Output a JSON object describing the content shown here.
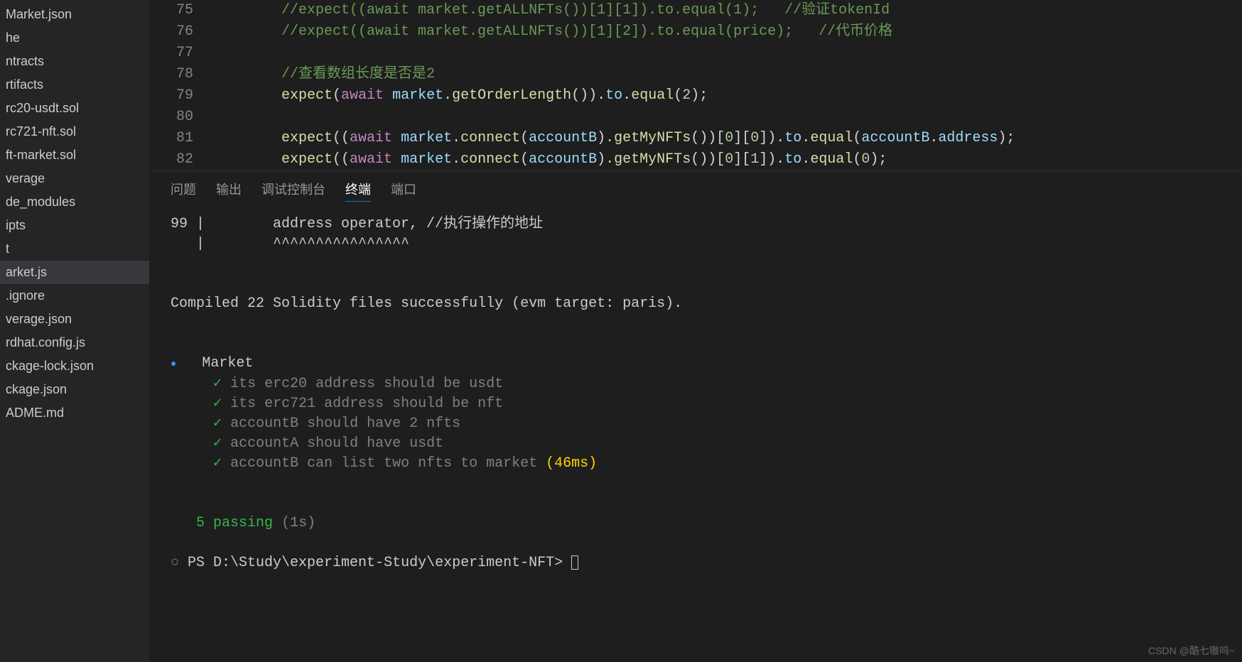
{
  "sidebar": {
    "items": [
      {
        "label": "Market.json"
      },
      {
        "label": "he"
      },
      {
        "label": "ntracts"
      },
      {
        "label": "rtifacts"
      },
      {
        "label": "rc20-usdt.sol"
      },
      {
        "label": "rc721-nft.sol"
      },
      {
        "label": "ft-market.sol"
      },
      {
        "label": "verage"
      },
      {
        "label": "de_modules"
      },
      {
        "label": "ipts"
      },
      {
        "label": "t"
      },
      {
        "label": "arket.js"
      },
      {
        "label": ".ignore"
      },
      {
        "label": "verage.json"
      },
      {
        "label": "rdhat.config.js"
      },
      {
        "label": "ckage-lock.json"
      },
      {
        "label": "ckage.json"
      },
      {
        "label": "ADME.md"
      }
    ],
    "active_index": 11
  },
  "editor": {
    "lines": [
      {
        "num": "75",
        "html": "<span class='c-comment'>//expect((await market.getALLNFTs())[1][1]).to.equal(1);   //验证tokenId</span>"
      },
      {
        "num": "76",
        "html": "<span class='c-comment'>//expect((await market.getALLNFTs())[1][2]).to.equal(price);   //代币价格</span>"
      },
      {
        "num": "77",
        "html": ""
      },
      {
        "num": "78",
        "html": "<span class='c-comment'>//查看数组长度是否是2</span>"
      },
      {
        "num": "79",
        "html": "<span class='c-func'>expect</span><span class='c-punct'>(</span><span class='c-await'>await</span> <span class='c-ident'>market</span><span class='c-punct'>.</span><span class='c-func'>getOrderLength</span><span class='c-punct'>()).</span><span class='c-ident'>to</span><span class='c-punct'>.</span><span class='c-func'>equal</span><span class='c-punct'>(</span><span class='c-num'>2</span><span class='c-punct'>);</span>"
      },
      {
        "num": "80",
        "html": ""
      },
      {
        "num": "81",
        "html": "<span class='c-func'>expect</span><span class='c-punct'>((</span><span class='c-await'>await</span> <span class='c-ident'>market</span><span class='c-punct'>.</span><span class='c-func'>connect</span><span class='c-punct'>(</span><span class='c-ident'>accountB</span><span class='c-punct'>).</span><span class='c-func'>getMyNFTs</span><span class='c-punct'>())[</span><span class='c-num'>0</span><span class='c-punct'>][</span><span class='c-num'>0</span><span class='c-punct'>]).</span><span class='c-ident'>to</span><span class='c-punct'>.</span><span class='c-func'>equal</span><span class='c-punct'>(</span><span class='c-ident'>accountB</span><span class='c-punct'>.</span><span class='c-prop'>address</span><span class='c-punct'>);</span>"
      },
      {
        "num": "82",
        "html": "<span class='c-func'>expect</span><span class='c-punct'>((</span><span class='c-await'>await</span> <span class='c-ident'>market</span><span class='c-punct'>.</span><span class='c-func'>connect</span><span class='c-punct'>(</span><span class='c-ident'>accountB</span><span class='c-punct'>).</span><span class='c-func'>getMyNFTs</span><span class='c-punct'>())[</span><span class='c-num'>0</span><span class='c-punct'>][</span><span class='c-num'>1</span><span class='c-punct'>]).</span><span class='c-ident'>to</span><span class='c-punct'>.</span><span class='c-func'>equal</span><span class='c-punct'>(</span><span class='c-num'>0</span><span class='c-punct'>);</span>"
      }
    ],
    "indent": "        "
  },
  "panel": {
    "tabs": [
      {
        "label": "问题"
      },
      {
        "label": "输出"
      },
      {
        "label": "调试控制台"
      },
      {
        "label": "终端"
      },
      {
        "label": "端口"
      }
    ],
    "active_tab": 3
  },
  "terminal": {
    "compile_line_num": "99 |",
    "compile_code": "        address operator, //执行操作的地址",
    "compile_caret_prefix": "   |",
    "compile_carets": "        ^^^^^^^^^^^^^^^^",
    "compiled_msg": "Compiled 22 Solidity files successfully (evm target: paris).",
    "suite_name": "Market",
    "tests": [
      {
        "name": "its erc20 address should be usdt",
        "time": ""
      },
      {
        "name": "its erc721 address should be nft",
        "time": ""
      },
      {
        "name": "accountB should have 2 nfts",
        "time": ""
      },
      {
        "name": "accountA should have usdt",
        "time": ""
      },
      {
        "name": "accountB can list two nfts to market",
        "time": "(46ms)"
      }
    ],
    "passing_text": "5 passing",
    "passing_time": "(1s)",
    "prompt": "PS D:\\Study\\experiment-Study\\experiment-NFT> "
  },
  "watermark": "CSDN @酷七嗷呜~"
}
